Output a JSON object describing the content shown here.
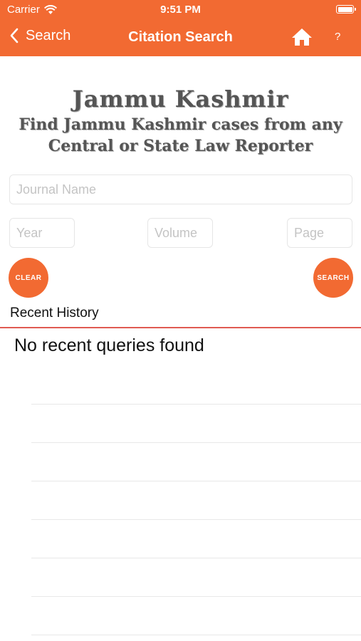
{
  "status_bar": {
    "carrier": "Carrier",
    "time": "9:51 PM"
  },
  "nav": {
    "back_label": "Search",
    "title": "Citation Search",
    "help_label": "?"
  },
  "heading": {
    "title": "Jammu Kashmir",
    "subtitle_line1": "Find Jammu Kashmir cases from any",
    "subtitle_line2": "Central or State Law Reporter"
  },
  "form": {
    "journal_placeholder": "Journal Name",
    "year_placeholder": "Year",
    "volume_placeholder": "Volume",
    "page_placeholder": "Page",
    "clear_label": "CLEAR",
    "search_label": "SEARCH"
  },
  "history": {
    "label": "Recent History",
    "empty_message": "No recent queries found"
  },
  "colors": {
    "accent": "#f26a32",
    "divider": "#e05a52"
  }
}
